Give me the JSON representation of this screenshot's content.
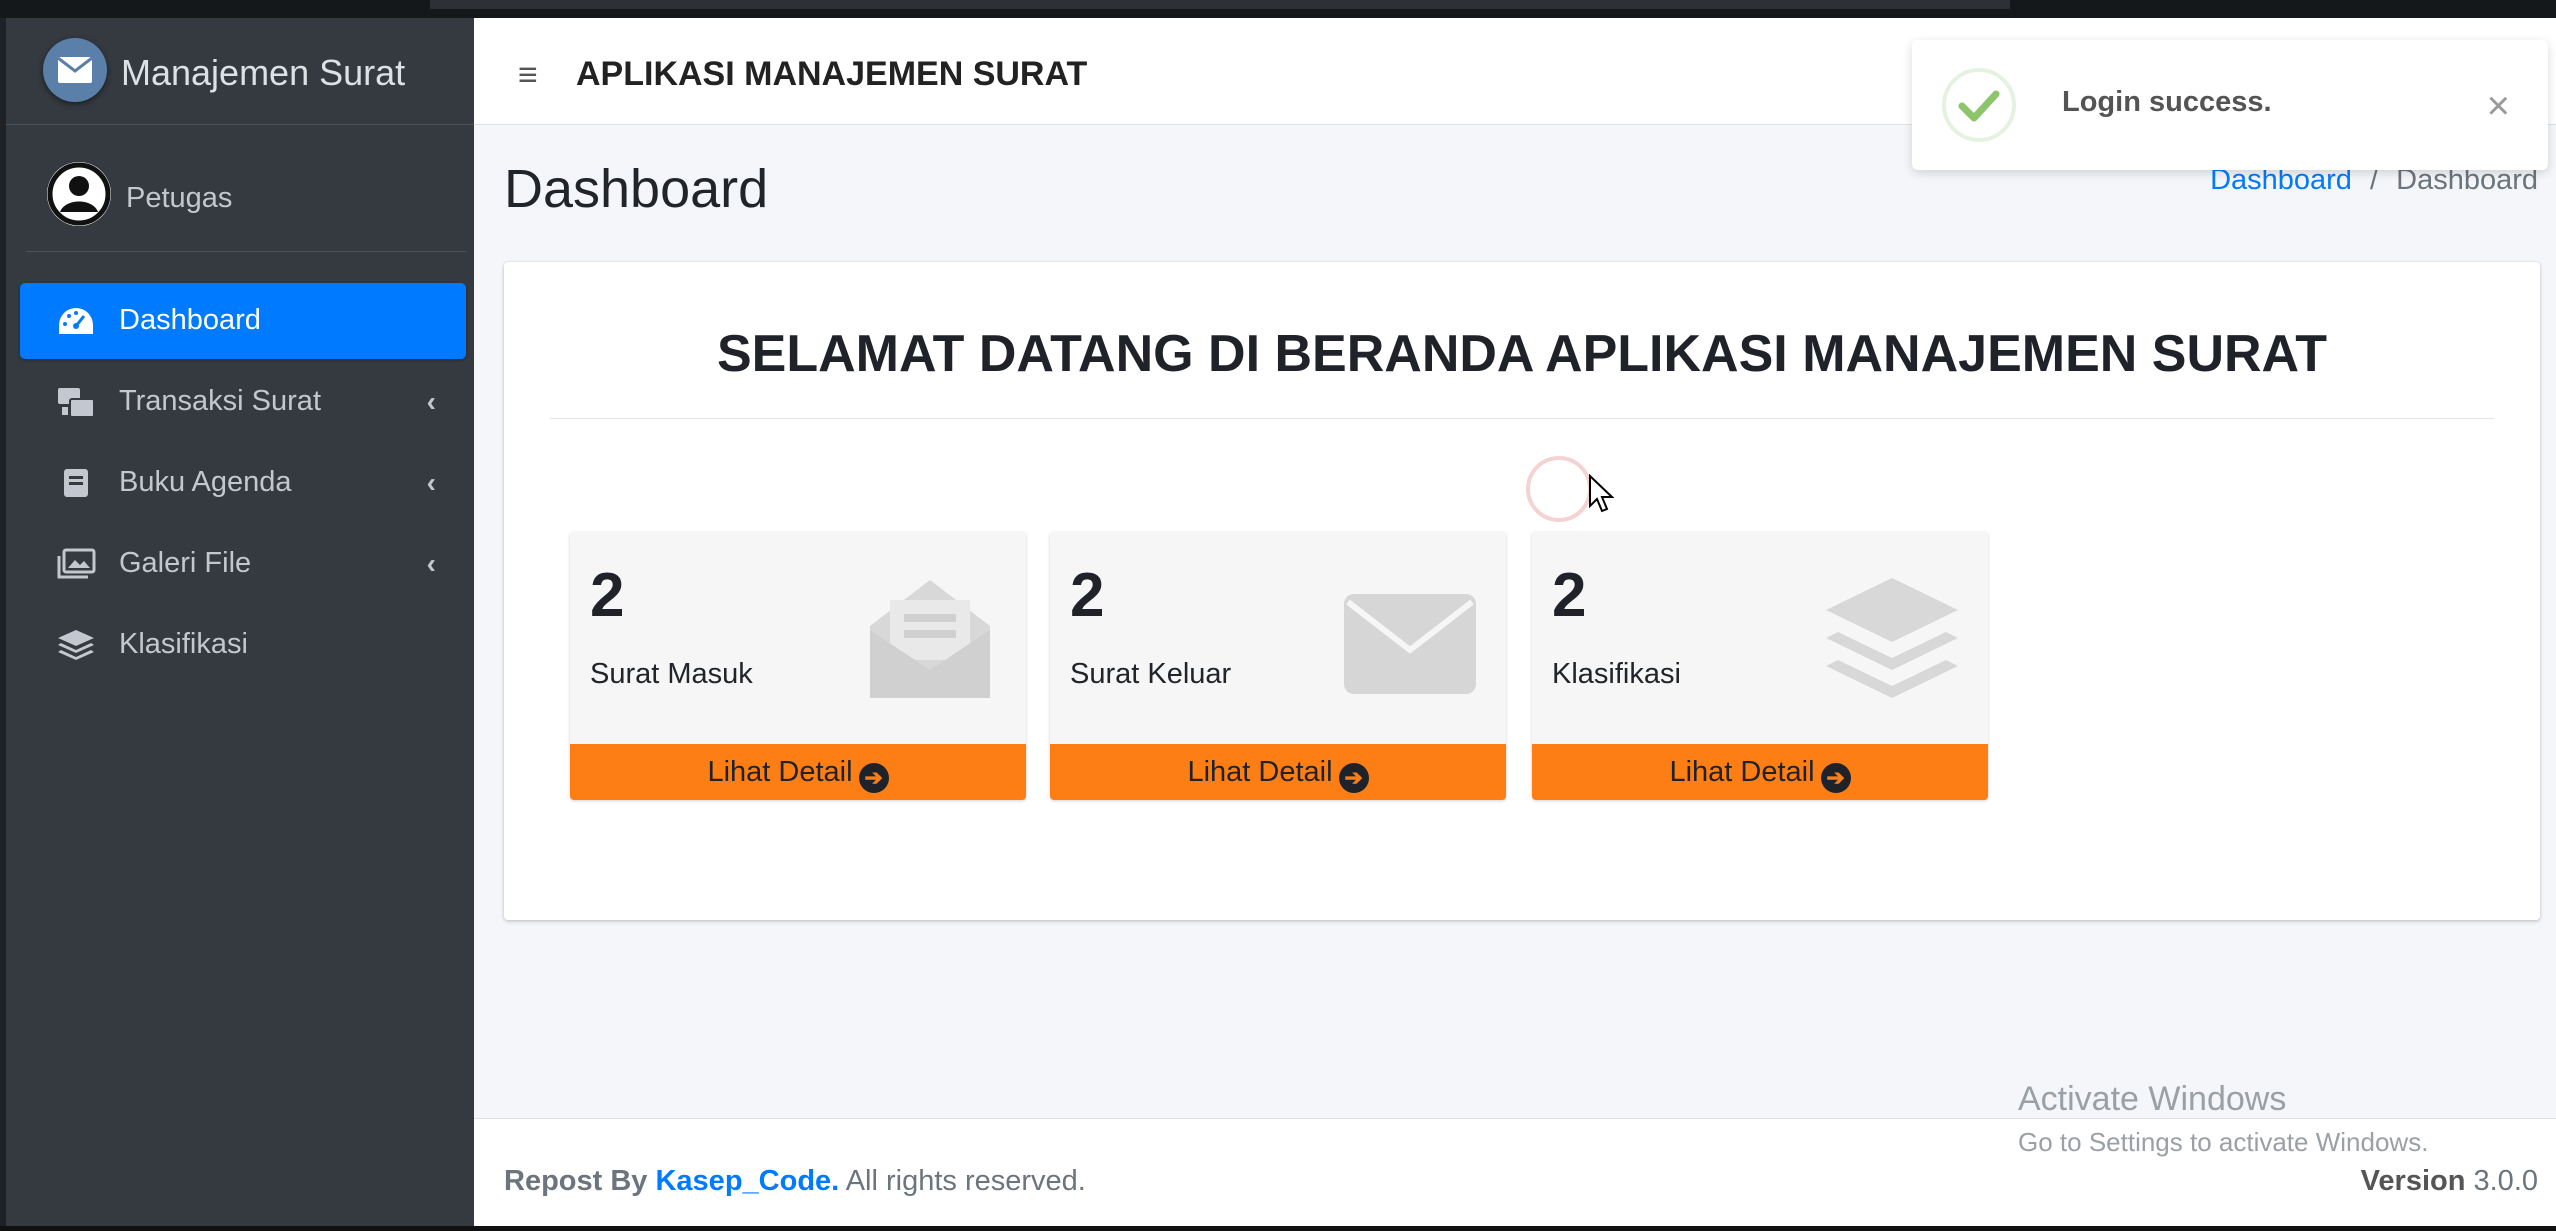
{
  "sidebar": {
    "brand": "Manajemen Surat",
    "user": "Petugas",
    "items": [
      {
        "label": "Dashboard",
        "icon": "tachometer-icon",
        "active": true
      },
      {
        "label": "Transaksi Surat",
        "icon": "mail-bulk-icon",
        "chevron": "‹"
      },
      {
        "label": "Buku Agenda",
        "icon": "book-icon",
        "chevron": "‹"
      },
      {
        "label": "Galeri File",
        "icon": "images-icon",
        "chevron": "‹"
      },
      {
        "label": "Klasifikasi",
        "icon": "layer-group-icon"
      }
    ]
  },
  "header": {
    "menu_icon": "≡",
    "title": "APLIKASI MANAJEMEN SURAT"
  },
  "page": {
    "title": "Dashboard",
    "breadcrumb": {
      "link": "Dashboard",
      "separator": "/",
      "current": "Dashboard"
    }
  },
  "welcome": "SELAMAT DATANG DI BERANDA APLIKASI MANAJEMEN SURAT",
  "boxes": [
    {
      "count": "2",
      "label": "Surat Masuk",
      "footer": "Lihat Detail",
      "icon": "envelope-open-text-icon"
    },
    {
      "count": "2",
      "label": "Surat Keluar",
      "footer": "Lihat Detail",
      "icon": "envelope-icon"
    },
    {
      "count": "2",
      "label": "Klasifikasi",
      "footer": "Lihat Detail",
      "icon": "layer-group-icon"
    }
  ],
  "footer": {
    "prefix": "Repost By",
    "brand": "Kasep_Code.",
    "suffix": "All rights reserved.",
    "version_label": "Version",
    "version": "3.0.0"
  },
  "windows": {
    "line1": "Activate Windows",
    "line2": "Go to Settings to activate Windows."
  },
  "toast": {
    "message": "Login success.",
    "close": "×"
  },
  "colors": {
    "sidebar": "#343a40",
    "active": "#007bff",
    "box_footer": "#fd7e14",
    "link": "#007bff"
  }
}
